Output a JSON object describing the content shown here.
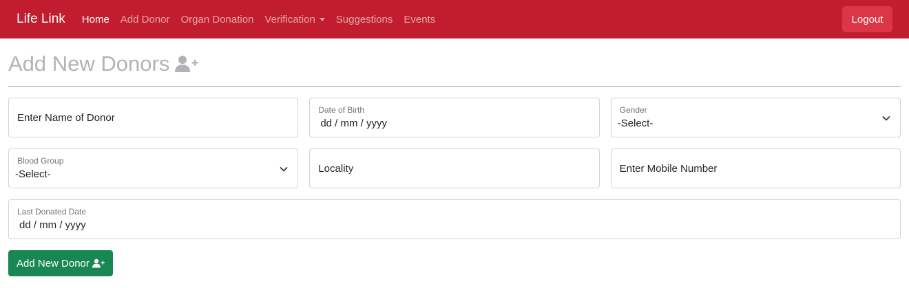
{
  "navbar": {
    "brand": "Life Link",
    "links": [
      "Home",
      "Add Donor",
      "Organ Donation",
      "Verification",
      "Suggestions",
      "Events"
    ],
    "logout": "Logout"
  },
  "page": {
    "title": "Add New Donors",
    "title_icon": "user-plus-icon"
  },
  "form": {
    "name_placeholder": "Enter Name of Donor",
    "dob_label": "Date of Birth",
    "dob_value": "dd / mm / yyyy",
    "gender_label": "Gender",
    "gender_value": "-Select-",
    "blood_group_label": "Blood Group",
    "blood_group_value": "-Select-",
    "locality_placeholder": "Locality",
    "mobile_placeholder": "Enter Mobile Number",
    "last_donated_label": "Last Donated Date",
    "last_donated_value": "dd / mm / yyyy",
    "submit_label": "Add New Donor",
    "submit_icon": "user-plus-icon"
  },
  "colors": {
    "navbar_bg": "#c11d2f",
    "logout_bg": "#dc3545",
    "submit_bg": "#198754",
    "title_color": "#b0b3b8"
  }
}
